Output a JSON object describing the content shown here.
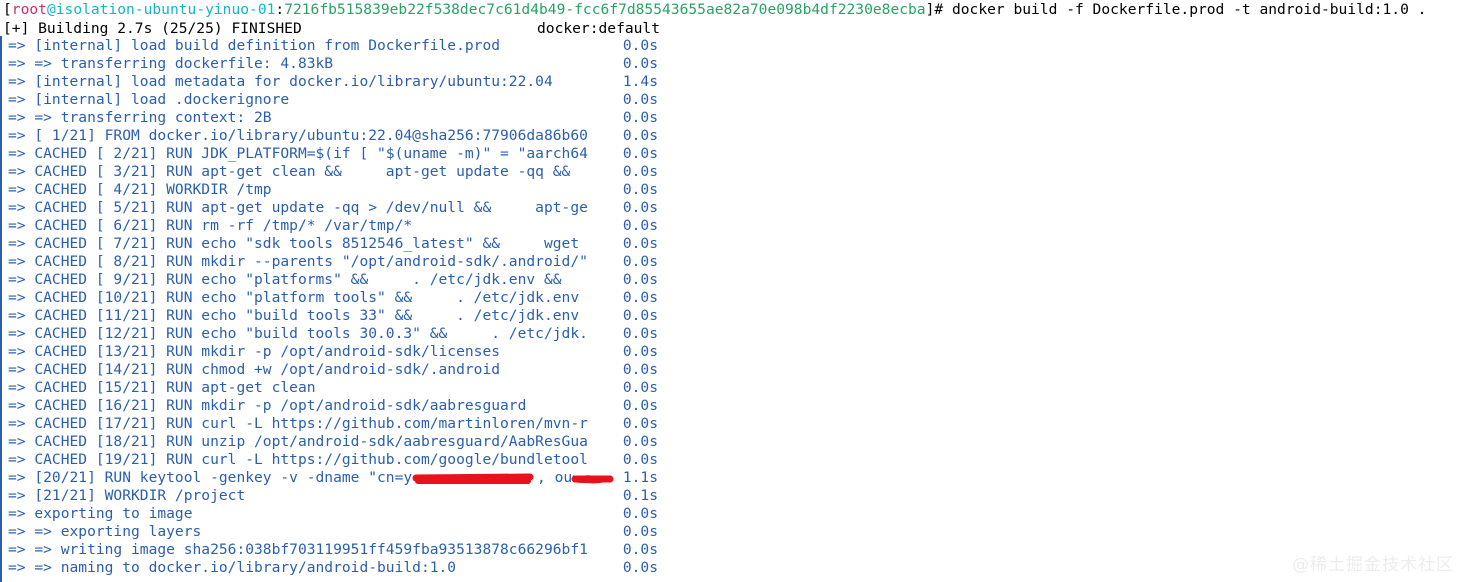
{
  "terminal": {
    "background_color": "#ffffff",
    "default_text_color": "#000000",
    "step_text_color": "#2b5fad",
    "redaction_color": "#e8121d"
  },
  "prompt": {
    "open_bracket": "[",
    "user": "root",
    "at": "@",
    "host": "isolation-ubuntu-yinuo-01",
    "colon": ":",
    "path": "7216fb515839eb22f538dec7c61d4b49-fcc6f7d85543655ae82a70e098b4df2230e8ecba",
    "close_bracket_hash": "]# ",
    "command": "docker build -f Dockerfile.prod -t android-build:1.0 .",
    "user_color": "#c0317a",
    "host_color": "#12b6c4",
    "path_color": "#27a365"
  },
  "building": {
    "summary": "[+] Building 2.7s (25/25) FINISHED",
    "driver": "docker:default"
  },
  "steps": [
    {
      "text": "=> [internal] load build definition from Dockerfile.prod",
      "time": "0.0s"
    },
    {
      "text": "=> => transferring dockerfile: 4.83kB",
      "time": "0.0s"
    },
    {
      "text": "=> [internal] load metadata for docker.io/library/ubuntu:22.04",
      "time": "1.4s"
    },
    {
      "text": "=> [internal] load .dockerignore",
      "time": "0.0s"
    },
    {
      "text": "=> => transferring context: 2B",
      "time": "0.0s"
    },
    {
      "text": "=> [ 1/21] FROM docker.io/library/ubuntu:22.04@sha256:77906da86b60",
      "time": "0.0s"
    },
    {
      "text": "=> CACHED [ 2/21] RUN JDK_PLATFORM=$(if [ \"$(uname -m)\" = \"aarch64",
      "time": "0.0s"
    },
    {
      "text": "=> CACHED [ 3/21] RUN apt-get clean &&     apt-get update -qq &&",
      "time": "0.0s"
    },
    {
      "text": "=> CACHED [ 4/21] WORKDIR /tmp",
      "time": "0.0s"
    },
    {
      "text": "=> CACHED [ 5/21] RUN apt-get update -qq > /dev/null &&     apt-ge",
      "time": "0.0s"
    },
    {
      "text": "=> CACHED [ 6/21] RUN rm -rf /tmp/* /var/tmp/*",
      "time": "0.0s"
    },
    {
      "text": "=> CACHED [ 7/21] RUN echo \"sdk tools 8512546_latest\" &&     wget",
      "time": "0.0s"
    },
    {
      "text": "=> CACHED [ 8/21] RUN mkdir --parents \"/opt/android-sdk/.android/\"",
      "time": "0.0s"
    },
    {
      "text": "=> CACHED [ 9/21] RUN echo \"platforms\" &&     . /etc/jdk.env &&",
      "time": "0.0s"
    },
    {
      "text": "=> CACHED [10/21] RUN echo \"platform tools\" &&     . /etc/jdk.env",
      "time": "0.0s"
    },
    {
      "text": "=> CACHED [11/21] RUN echo \"build tools 33\" &&     . /etc/jdk.env",
      "time": "0.0s"
    },
    {
      "text": "=> CACHED [12/21] RUN echo \"build tools 30.0.3\" &&     . /etc/jdk.",
      "time": "0.0s"
    },
    {
      "text": "=> CACHED [13/21] RUN mkdir -p /opt/android-sdk/licenses",
      "time": "0.0s"
    },
    {
      "text": "=> CACHED [14/21] RUN chmod +w /opt/android-sdk/.android",
      "time": "0.0s"
    },
    {
      "text": "=> CACHED [15/21] RUN apt-get clean",
      "time": "0.0s"
    },
    {
      "text": "=> CACHED [16/21] RUN mkdir -p /opt/android-sdk/aabresguard",
      "time": "0.0s"
    },
    {
      "text": "=> CACHED [17/21] RUN curl -L https://github.com/martinloren/mvn-r",
      "time": "0.0s"
    },
    {
      "text": "=> CACHED [18/21] RUN unzip /opt/android-sdk/aabresguard/AabResGua",
      "time": "0.0s"
    },
    {
      "text": "=> CACHED [19/21] RUN curl -L https://github.com/google/bundletool",
      "time": "0.0s"
    },
    {
      "text": "=> [20/21] RUN keytool -genkey -v -dname \"cn=y",
      "time": "1.1s",
      "redacted": true,
      "suffix": ", ou="
    },
    {
      "text": "=> [21/21] WORKDIR /project",
      "time": "0.1s"
    },
    {
      "text": "=> exporting to image",
      "time": "0.0s"
    },
    {
      "text": "=> => exporting layers",
      "time": "0.0s"
    },
    {
      "text": "=> => writing image sha256:038bf703119951ff459fba93513878c66296bf1",
      "time": "0.0s"
    },
    {
      "text": "=> => naming to docker.io/library/android-build:1.0",
      "time": "0.0s"
    }
  ],
  "watermark": {
    "text": "@稀土掘金技术社区"
  }
}
